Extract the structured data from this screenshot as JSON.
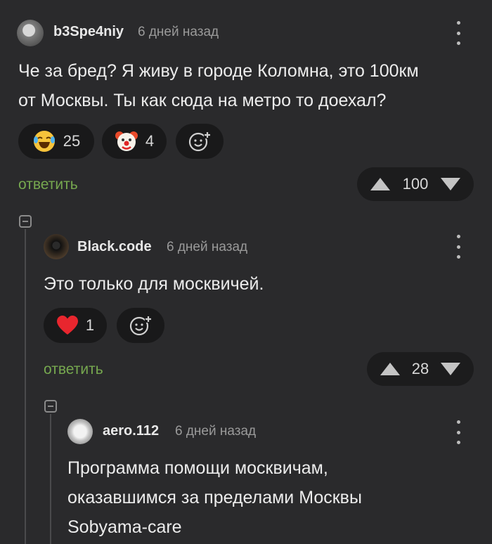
{
  "comments": [
    {
      "username": "b3Spe4niy",
      "time": "6 дней назад",
      "text_lines": [
        "Че за бред? Я живу в городе Коломна, это 100км",
        "от Москвы. Ты как сюда на метро то доехал?"
      ],
      "reactions": [
        {
          "icon": "laughing-emoji-icon",
          "count": "25"
        },
        {
          "icon": "clown-emoji-icon",
          "count": "4"
        }
      ],
      "reply_label": "ответить",
      "rating": "100"
    },
    {
      "username": "Black.code",
      "time": "6 дней назад",
      "text_lines": [
        "Это только для москвичей."
      ],
      "reactions": [
        {
          "icon": "heart-icon",
          "count": "1"
        }
      ],
      "reply_label": "ответить",
      "rating": "28"
    },
    {
      "username": "aero.112",
      "time": "6 дней назад",
      "text_lines": [
        "Программа помощи москвичам,",
        "оказавшимся за пределами Москвы",
        "Sobyama-care"
      ]
    }
  ],
  "colors": {
    "background": "#2a2a2c",
    "reply": "#76a84f",
    "pill": "#19191a"
  }
}
